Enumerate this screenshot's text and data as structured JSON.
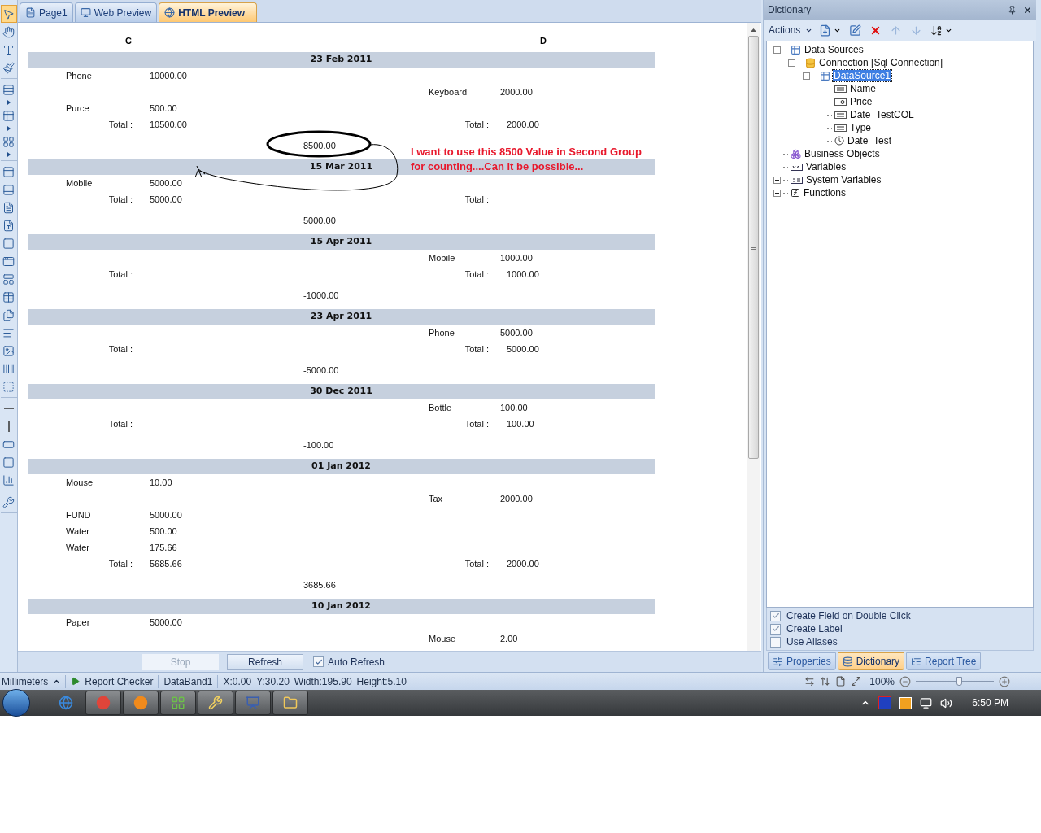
{
  "tabs": [
    {
      "label": "Page1",
      "kind": "page",
      "selected": false
    },
    {
      "label": "Web Preview",
      "kind": "web",
      "selected": false
    },
    {
      "label": "HTML Preview",
      "kind": "html",
      "selected": true
    }
  ],
  "toolbox": {
    "groups": [
      {
        "tools": [
          {
            "kind": "pointer",
            "selected": true
          },
          {
            "kind": "hand",
            "selected": false
          },
          {
            "kind": "text",
            "selected": false
          },
          {
            "kind": "brush",
            "selected": false
          }
        ]
      },
      {
        "tools": [
          {
            "kind": "band",
            "selected": false
          },
          {
            "kind": "expand",
            "selected": false
          },
          {
            "kind": "table-band",
            "selected": false
          },
          {
            "kind": "expand",
            "selected": false
          },
          {
            "kind": "cross-band",
            "selected": false
          },
          {
            "kind": "expand",
            "selected": false
          }
        ]
      },
      {
        "tools": [
          {
            "kind": "header",
            "selected": false
          },
          {
            "kind": "footer",
            "selected": false
          },
          {
            "kind": "text-a",
            "selected": false
          },
          {
            "kind": "text-b",
            "selected": false
          },
          {
            "kind": "panel",
            "selected": false
          },
          {
            "kind": "panel-b",
            "selected": false
          },
          {
            "kind": "container",
            "selected": false
          },
          {
            "kind": "table",
            "selected": false
          },
          {
            "kind": "subreport",
            "selected": false
          },
          {
            "kind": "rich-text",
            "selected": false
          },
          {
            "kind": "image",
            "selected": false
          },
          {
            "kind": "barcode",
            "selected": false
          },
          {
            "kind": "dashed",
            "selected": false
          }
        ]
      },
      {
        "tools": [
          {
            "kind": "hline",
            "selected": false
          },
          {
            "kind": "vline",
            "selected": false
          },
          {
            "kind": "rect",
            "selected": false
          },
          {
            "kind": "roundrect",
            "selected": false
          },
          {
            "kind": "chart",
            "selected": false
          }
        ]
      },
      {
        "tools": [
          {
            "kind": "tools",
            "selected": false
          }
        ]
      }
    ]
  },
  "report": {
    "columns": [
      "C",
      "D"
    ],
    "groups": [
      {
        "date": "23 Feb 2011",
        "rows": [
          {
            "kind": "item",
            "left": {
              "label": "Phone",
              "value": "10000.00"
            }
          },
          {
            "kind": "item",
            "right": {
              "label": "Keyboard",
              "value": "2000.00"
            }
          },
          {
            "kind": "item",
            "left": {
              "label": "Purce",
              "value": "500.00"
            }
          },
          {
            "kind": "total",
            "left": {
              "label": "Total :",
              "value": "10500.00"
            },
            "right": {
              "label": "Total :",
              "value": "2000.00"
            }
          }
        ],
        "summary": {
          "value": "8500.00",
          "circled": true
        }
      },
      {
        "date": "15 Mar 2011",
        "rows": [
          {
            "kind": "item",
            "left": {
              "label": "Mobile",
              "value": "5000.00"
            }
          },
          {
            "kind": "total",
            "left": {
              "label": "Total :",
              "value": "5000.00"
            },
            "right": {
              "label": "Total :"
            }
          }
        ],
        "summary": {
          "value": "5000.00"
        }
      },
      {
        "date": "15 Apr 2011",
        "rows": [
          {
            "kind": "item",
            "right": {
              "label": "Mobile",
              "value": "1000.00"
            }
          },
          {
            "kind": "total",
            "left": {
              "label": "Total :"
            },
            "right": {
              "label": "Total :",
              "value": "1000.00"
            }
          }
        ],
        "summary": {
          "value": "-1000.00"
        }
      },
      {
        "date": "23 Apr 2011",
        "rows": [
          {
            "kind": "item",
            "right": {
              "label": "Phone",
              "value": "5000.00"
            }
          },
          {
            "kind": "total",
            "left": {
              "label": "Total :"
            },
            "right": {
              "label": "Total :",
              "value": "5000.00"
            }
          }
        ],
        "summary": {
          "value": "-5000.00"
        }
      },
      {
        "date": "30 Dec 2011",
        "rows": [
          {
            "kind": "item",
            "right": {
              "label": "Bottle",
              "value": "100.00"
            }
          },
          {
            "kind": "total",
            "left": {
              "label": "Total :"
            },
            "right": {
              "label": "Total :",
              "value": "100.00"
            }
          }
        ],
        "summary": {
          "value": "-100.00"
        }
      },
      {
        "date": "01 Jan 2012",
        "rows": [
          {
            "kind": "item",
            "left": {
              "label": "Mouse",
              "value": "10.00"
            }
          },
          {
            "kind": "item",
            "right": {
              "label": "Tax",
              "value": "2000.00"
            }
          },
          {
            "kind": "item",
            "left": {
              "label": "FUND",
              "value": "5000.00"
            }
          },
          {
            "kind": "item",
            "left": {
              "label": "Water",
              "value": "500.00"
            }
          },
          {
            "kind": "item",
            "left": {
              "label": "Water",
              "value": "175.66"
            }
          },
          {
            "kind": "total",
            "left": {
              "label": "Total :",
              "value": "5685.66"
            },
            "right": {
              "label": "Total :",
              "value": "2000.00"
            }
          }
        ],
        "summary": {
          "value": "3685.66"
        }
      },
      {
        "date": "10 Jan 2012",
        "rows": [
          {
            "kind": "item",
            "left": {
              "label": "Paper",
              "value": "5000.00"
            }
          },
          {
            "kind": "item",
            "right": {
              "label": "Mouse",
              "value": "2.00"
            }
          }
        ]
      }
    ]
  },
  "annotation": {
    "lines": [
      "I want to use this 8500 Value in Second Group",
      "for counting....Can it be possible..."
    ]
  },
  "preview_bar": {
    "buttons": [
      {
        "label": "Stop",
        "disabled": true
      },
      {
        "label": "Refresh",
        "disabled": false
      }
    ],
    "auto_refresh": {
      "label": "Auto Refresh",
      "checked": true
    }
  },
  "dictionary": {
    "title": "Dictionary",
    "actions_label": "Actions",
    "toolbar": [
      {
        "kind": "new",
        "disabled": false
      },
      {
        "kind": "edit",
        "disabled": false
      },
      {
        "kind": "delete",
        "disabled": false
      },
      {
        "kind": "up",
        "disabled": true
      },
      {
        "kind": "down",
        "disabled": true
      },
      {
        "kind": "sort",
        "disabled": false
      }
    ],
    "tree": [
      {
        "label": "Data Sources",
        "kind": "table",
        "selected": false,
        "expanded": true,
        "children": [
          {
            "label": "Connection [Sql Connection]",
            "kind": "database",
            "selected": false,
            "expanded": true,
            "children": [
              {
                "label": "DataSource1",
                "kind": "table",
                "selected": true,
                "expanded": true,
                "children": [
                  {
                    "label": "Name",
                    "kind": "field-text",
                    "selected": false
                  },
                  {
                    "label": "Price",
                    "kind": "field-number",
                    "selected": false
                  },
                  {
                    "label": "Date_TestCOL",
                    "kind": "field-text",
                    "selected": false
                  },
                  {
                    "label": "Type",
                    "kind": "field-text",
                    "selected": false
                  },
                  {
                    "label": "Date_Test",
                    "kind": "field-date",
                    "selected": false
                  }
                ]
              }
            ]
          }
        ]
      },
      {
        "label": "Business Objects",
        "kind": "objects",
        "selected": false
      },
      {
        "label": "Variables",
        "kind": "variables",
        "selected": false
      },
      {
        "label": "System Variables",
        "kind": "sysvars",
        "selected": false,
        "expanded": false
      },
      {
        "label": "Functions",
        "kind": "functions",
        "selected": false,
        "expanded": false
      }
    ],
    "options": [
      {
        "label": "Create Field on Double Click",
        "checked": true
      },
      {
        "label": "Create Label",
        "checked": true
      },
      {
        "label": "Use Aliases",
        "checked": false
      }
    ]
  },
  "panel_tabs": [
    {
      "label": "Properties",
      "kind": "properties",
      "selected": false
    },
    {
      "label": "Dictionary",
      "kind": "dictionary",
      "selected": true
    },
    {
      "label": "Report Tree",
      "kind": "tree",
      "selected": false
    }
  ],
  "status_bar": {
    "units": "Millimeters",
    "checker": "Report Checker",
    "component": "DataBand1",
    "coords": [
      "X:0.00",
      "Y:30.20",
      "Width:195.90",
      "Height:5.10"
    ],
    "zoom": "100%",
    "zoom_slider": {
      "level": 0.55
    }
  },
  "taskbar": {
    "items": [
      {
        "kind": "globe",
        "running": false
      },
      {
        "kind": "round",
        "running": true
      },
      {
        "kind": "fox",
        "running": true
      },
      {
        "kind": "grid",
        "running": true
      },
      {
        "kind": "tools",
        "running": true
      },
      {
        "kind": "chart",
        "running": true
      },
      {
        "kind": "folder",
        "running": true
      }
    ],
    "clock": "6:50 PM"
  }
}
